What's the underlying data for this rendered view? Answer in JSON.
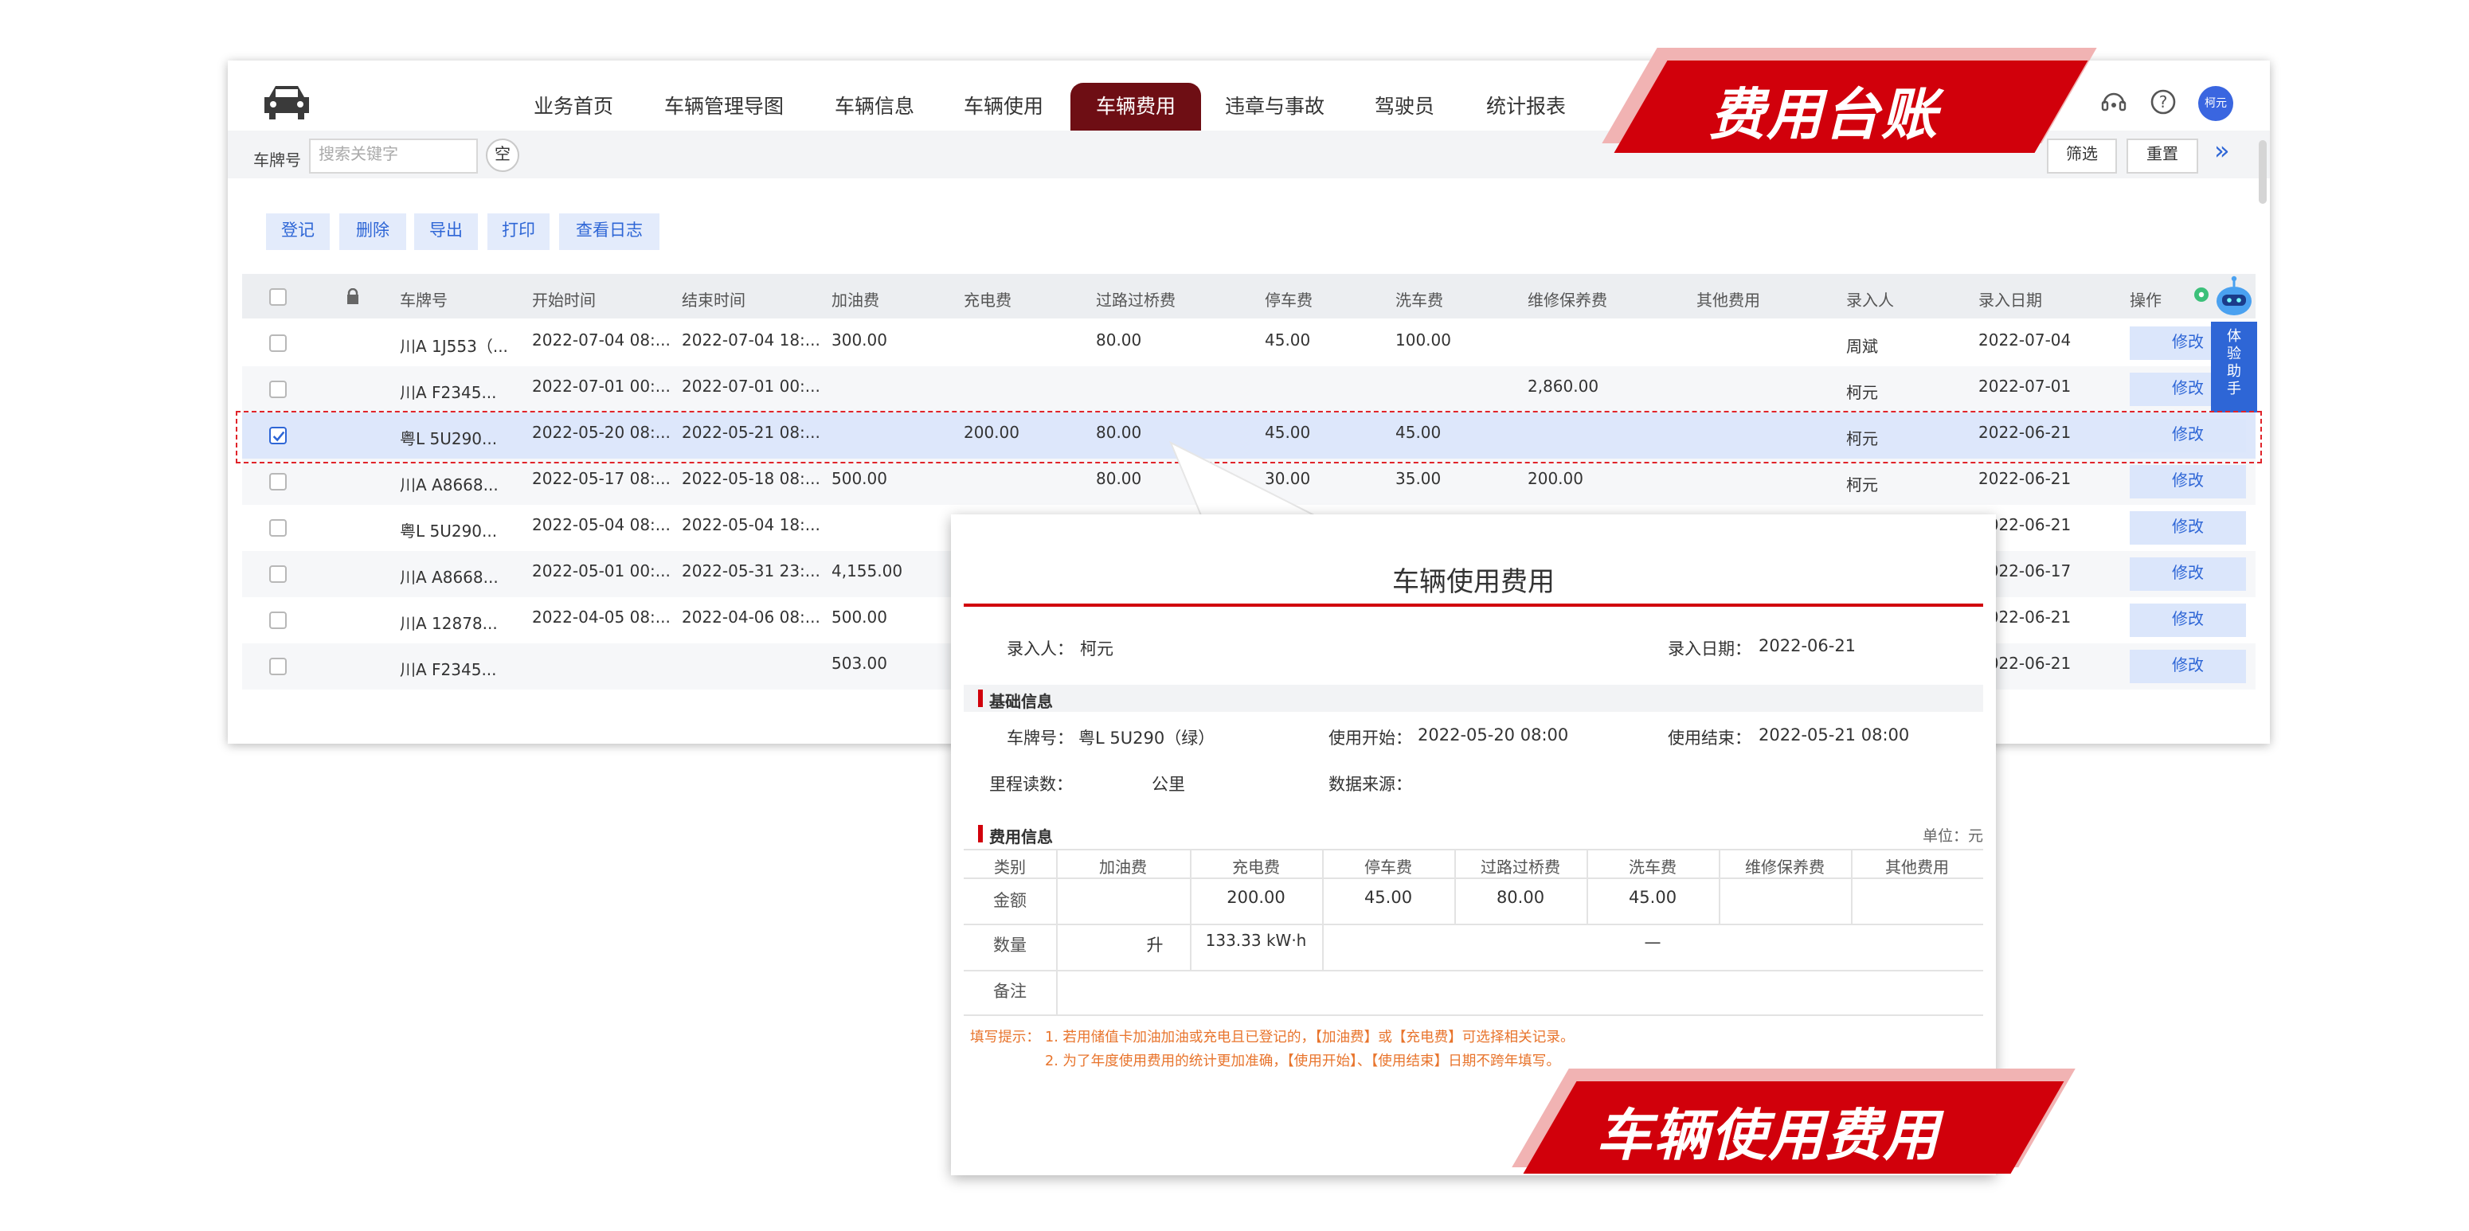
{
  "nav": {
    "items": [
      "业务首页",
      "车辆管理导图",
      "车辆信息",
      "车辆使用",
      "车辆费用",
      "违章与事故",
      "驾驶员",
      "统计报表"
    ],
    "active": "车辆费用",
    "avatar_text": "柯元",
    "accent_color": "#6e0e14"
  },
  "search": {
    "label": "车牌号",
    "placeholder": "搜索关键字",
    "clear_label": "空",
    "filter_label": "筛选",
    "reset_label": "重置",
    "expand_icon": "»"
  },
  "actions": [
    "登记",
    "删除",
    "导出",
    "打印",
    "查看日志"
  ],
  "table": {
    "columns": [
      "车牌号",
      "开始时间",
      "结束时间",
      "加油费",
      "充电费",
      "过路过桥费",
      "停车费",
      "洗车费",
      "维修保养费",
      "其他费用",
      "录入人",
      "录入日期",
      "操作"
    ],
    "edit_label": "修改",
    "rows": [
      {
        "plate": "川A 1J553（...",
        "start": "2022-07-04 08:...",
        "end": "2022-07-04 18:...",
        "fuel": "300.00",
        "charge": "",
        "toll": "80.00",
        "park": "45.00",
        "wash": "100.00",
        "maint": "",
        "other": "",
        "user": "周斌",
        "date": "2022-07-04",
        "checked": false
      },
      {
        "plate": "川A F2345...",
        "start": "2022-07-01 00:...",
        "end": "2022-07-01 00:...",
        "fuel": "",
        "charge": "",
        "toll": "",
        "park": "",
        "wash": "",
        "maint": "2,860.00",
        "other": "",
        "user": "柯元",
        "date": "2022-07-01",
        "checked": false
      },
      {
        "plate": "粤L 5U290...",
        "start": "2022-05-20 08:...",
        "end": "2022-05-21 08:...",
        "fuel": "",
        "charge": "200.00",
        "toll": "80.00",
        "park": "45.00",
        "wash": "45.00",
        "maint": "",
        "other": "",
        "user": "柯元",
        "date": "2022-06-21",
        "checked": true
      },
      {
        "plate": "川A A8668...",
        "start": "2022-05-17 08:...",
        "end": "2022-05-18 08:...",
        "fuel": "500.00",
        "charge": "",
        "toll": "80.00",
        "park": "30.00",
        "wash": "35.00",
        "maint": "200.00",
        "other": "",
        "user": "柯元",
        "date": "2022-06-21",
        "checked": false
      },
      {
        "plate": "粤L 5U290...",
        "start": "2022-05-04 08:...",
        "end": "2022-05-04 18:...",
        "fuel": "",
        "charge": "",
        "toll": "",
        "park": "",
        "wash": "",
        "maint": "",
        "other": "",
        "user": "",
        "date": "2022-06-21",
        "checked": false
      },
      {
        "plate": "川A A8668...",
        "start": "2022-05-01 00:...",
        "end": "2022-05-31 23:...",
        "fuel": "4,155.00",
        "charge": "",
        "toll": "",
        "park": "",
        "wash": "",
        "maint": "",
        "other": "",
        "user": "",
        "date": "2022-06-17",
        "checked": false
      },
      {
        "plate": "川A 12878...",
        "start": "2022-04-05 08:...",
        "end": "2022-04-06 08:...",
        "fuel": "500.00",
        "charge": "",
        "toll": "",
        "park": "",
        "wash": "",
        "maint": "",
        "other": "",
        "user": "",
        "date": "2022-06-21",
        "checked": false
      },
      {
        "plate": "川A F2345...",
        "start": "",
        "end": "",
        "fuel": "503.00",
        "charge": "",
        "toll": "",
        "park": "",
        "wash": "",
        "maint": "",
        "other": "",
        "user": "",
        "date": "2022-06-21",
        "checked": false
      }
    ]
  },
  "assistant": {
    "label": [
      "体",
      "验",
      "助",
      "手"
    ]
  },
  "banners": {
    "top": "费用台账",
    "bottom": "车辆使用费用",
    "color": "#d1000b"
  },
  "popup": {
    "title": "车辆使用费用",
    "recorder_label": "录入人：",
    "recorder": "柯元",
    "record_date_label": "录入日期：",
    "record_date": "2022-06-21",
    "basic_section": "基础信息",
    "plate_label": "车牌号：",
    "plate": "粤L 5U290（绿）",
    "use_start_label": "使用开始：",
    "use_start": "2022-05-20 08:00",
    "use_end_label": "使用结束：",
    "use_end": "2022-05-21 08:00",
    "mileage_label": "里程读数：",
    "mileage_unit": "公里",
    "source_label": "数据来源：",
    "fee_section": "费用信息",
    "unit_note": "单位：元",
    "fee_columns": [
      "类别",
      "加油费",
      "充电费",
      "停车费",
      "过路过桥费",
      "洗车费",
      "维修保养费",
      "其他费用"
    ],
    "amount_label": "金额",
    "amounts": [
      "",
      "200.00",
      "45.00",
      "80.00",
      "45.00",
      "",
      ""
    ],
    "quantity_label": "数量",
    "fuel_unit": "升",
    "charge_qty": "133.33 kW·h",
    "qty_dash": "—",
    "note_label": "备注",
    "hint_title": "填写提示：",
    "hint1": "1. 若用储值卡加油加油或充电且已登记的，【加油费】或【充电费】可选择相关记录。",
    "hint2": "2. 为了年度使用费用的统计更加准确，【使用开始】、【使用结束】日期不跨年填写。"
  }
}
